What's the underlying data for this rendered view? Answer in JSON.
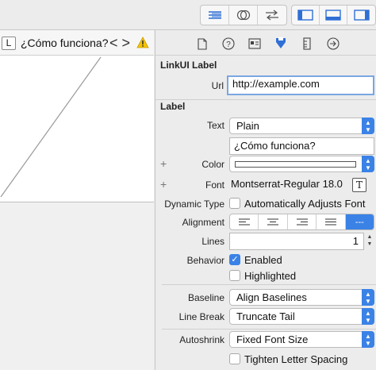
{
  "toolbar": {
    "editor_icons": [
      "align-left-lines-icon",
      "overlapping-circles-icon",
      "swap-arrows-icon"
    ],
    "panel_icons": [
      "left-panel-icon",
      "bottom-panel-icon",
      "right-panel-icon"
    ]
  },
  "jumpbar": {
    "badge": "L",
    "title": "¿Cómo funciona?",
    "back": "<",
    "forward": ">"
  },
  "inspector_tabs": [
    "file-icon",
    "help-icon",
    "identity-icon",
    "attributes-icon",
    "size-icon",
    "connections-icon"
  ],
  "linkui": {
    "section_title": "LinkUI Label",
    "url_label": "Url",
    "url_value": "http://example.com"
  },
  "label": {
    "section_title": "Label",
    "text_label": "Text",
    "text_type": "Plain",
    "text_value": "¿Cómo funciona?",
    "color_label": "Color",
    "color_value": "#ffffff",
    "font_label": "Font",
    "font_value": "Montserrat-Regular 18.0",
    "dynamic_type_label": "Dynamic Type",
    "dynamic_type_option": "Automatically Adjusts Font",
    "alignment_label": "Alignment",
    "alignment_selected": "---",
    "lines_label": "Lines",
    "lines_value": "1",
    "behavior_label": "Behavior",
    "behavior_enabled": "Enabled",
    "behavior_highlighted": "Highlighted",
    "baseline_label": "Baseline",
    "baseline_value": "Align Baselines",
    "linebreak_label": "Line Break",
    "linebreak_value": "Truncate Tail",
    "autoshrink_label": "Autoshrink",
    "autoshrink_value": "Fixed Font Size",
    "tighten_label": "Tighten Letter Spacing"
  },
  "colors": {
    "accent": "#3b82e6",
    "focus_ring": "#7aa7e0",
    "warning": "#f5c400"
  }
}
